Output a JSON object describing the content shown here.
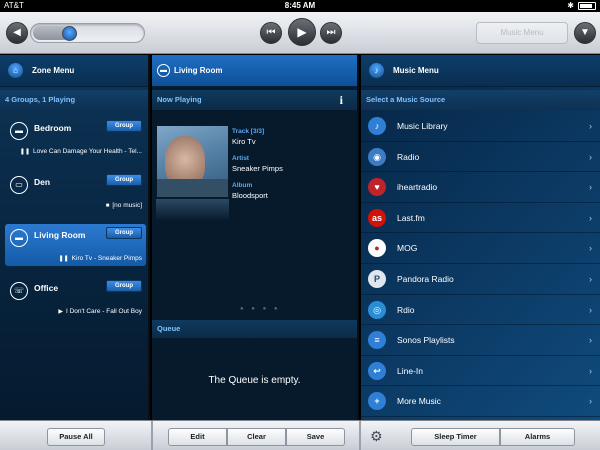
{
  "status": {
    "carrier": "AT&T",
    "time": "8:45 AM"
  },
  "toolbar": {
    "music_menu_button": "Music Menu",
    "volume": 0.3
  },
  "zones": {
    "header": "Zone Menu",
    "summary": "4 Groups, 1 Playing",
    "group_label": "Group",
    "items": [
      {
        "name": "Bedroom",
        "state": "paused",
        "symbol": "❚❚",
        "track": "Love Can Damage Your Health - Tel..."
      },
      {
        "name": "Den",
        "state": "stopped",
        "symbol": "■",
        "track": "[no music]"
      },
      {
        "name": "Living Room",
        "state": "paused",
        "symbol": "❚❚",
        "track": "Kiro Tv - Sneaker Pimps",
        "active": true
      },
      {
        "name": "Office",
        "state": "playing",
        "symbol": "▶",
        "track": "I Don't Care - Fall Out Boy"
      }
    ]
  },
  "now_playing": {
    "room": "Living Room",
    "header": "Now Playing",
    "info_icon": "i",
    "track_label": "Track [3/3]",
    "track": "Kiro Tv",
    "artist_label": "Artist",
    "artist": "Sneaker Pimps",
    "album_label": "Album",
    "album": "Bloodsport",
    "page_dots": "● ● ● ●"
  },
  "queue": {
    "header": "Queue",
    "empty_text": "The Queue is empty."
  },
  "music_menu": {
    "header": "Music Menu",
    "subheader": "Select a Music Source",
    "sources": [
      {
        "label": "Music Library",
        "icon": "music-note-icon",
        "color": "#2f7fd6",
        "glyph": "♪"
      },
      {
        "label": "Radio",
        "icon": "radio-icon",
        "color": "#3b7cc4",
        "glyph": "◉"
      },
      {
        "label": "iheartradio",
        "icon": "iheartradio-icon",
        "color": "#c0242a",
        "glyph": "♥"
      },
      {
        "label": "Last.fm",
        "icon": "lastfm-icon",
        "color": "#d51007",
        "glyph": "as"
      },
      {
        "label": "MOG",
        "icon": "mog-icon",
        "color": "#ffffff",
        "glyph": "●"
      },
      {
        "label": "Pandora Radio",
        "icon": "pandora-icon",
        "color": "#dfe6ee",
        "glyph": "P"
      },
      {
        "label": "Rdio",
        "icon": "rdio-icon",
        "color": "#2a8ed6",
        "glyph": "◎"
      },
      {
        "label": "Sonos Playlists",
        "icon": "playlist-icon",
        "color": "#2f7fd6",
        "glyph": "≡"
      },
      {
        "label": "Line-In",
        "icon": "line-in-icon",
        "color": "#2f7fd6",
        "glyph": "↩"
      },
      {
        "label": "More Music",
        "icon": "plus-icon",
        "color": "#2f7fd6",
        "glyph": "+"
      }
    ]
  },
  "bottom": {
    "pause_all": "Pause All",
    "edit": "Edit",
    "clear": "Clear",
    "save": "Save",
    "sleep_timer": "Sleep Timer",
    "alarms": "Alarms"
  }
}
